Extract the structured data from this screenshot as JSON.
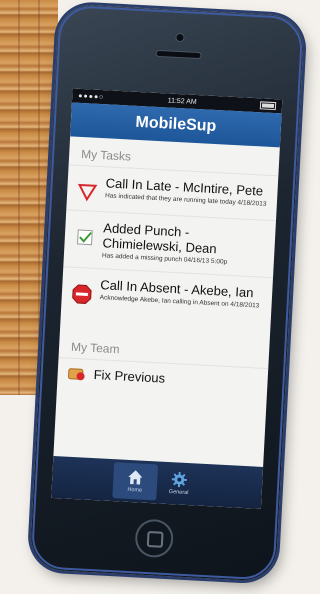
{
  "status_bar": {
    "carrier": "●●●●○",
    "time": "11:52 AM"
  },
  "app": {
    "title": "MobileSup"
  },
  "tasks": {
    "header": "My Tasks",
    "items": [
      {
        "title": "Call In Late - McIntire, Pete",
        "description": "Has indicated that they are running late today 4/18/2013",
        "icon": "late-triangle-icon"
      },
      {
        "title": "Added Punch - Chimielewski, Dean",
        "description": "Has added a missing punch 04/16/13 5:00p",
        "icon": "checkmark-icon"
      },
      {
        "title": "Call In Absent - Akebe, Ian",
        "description": "Acknowledge Akebe, Ian calling in Absent on 4/18/2013",
        "icon": "stop-sign-icon"
      }
    ]
  },
  "team": {
    "header": "My Team",
    "items": [
      {
        "label": "Fix Previous",
        "icon": "fix-previous-icon"
      }
    ]
  },
  "tabbar": {
    "tabs": [
      {
        "label": "Home",
        "icon": "home-icon",
        "active": true
      },
      {
        "label": "General",
        "icon": "gear-icon",
        "active": false
      }
    ]
  },
  "colors": {
    "navbar": "#1d5699",
    "tabbar": "#142441",
    "accent_red": "#d8262a",
    "accent_green": "#3a9a3a"
  }
}
